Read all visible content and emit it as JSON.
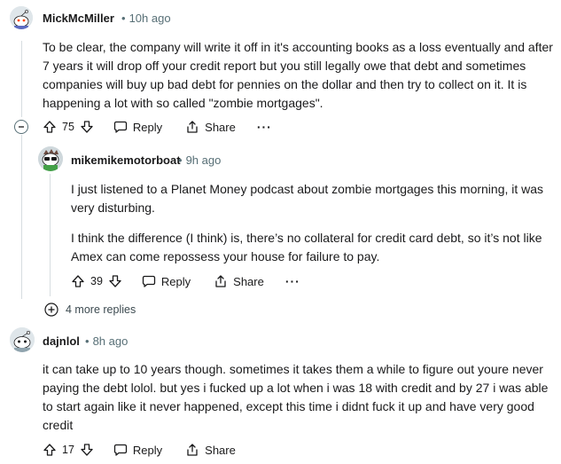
{
  "comments": [
    {
      "author": "MickMcMiller",
      "time": "10h ago",
      "lines": [
        "To be clear, the company will write it off in it's accounting books as a loss eventually and after",
        "7 years it will drop off your credit report but you still legally owe that debt and sometimes",
        "companies will buy up bad debt for pennies on the dollar and then try to collect on it. It is",
        "happening a lot with so called \"zombie mortgages\"."
      ],
      "votes": "75",
      "reply_label": "Reply",
      "share_label": "Share",
      "more_label": "···"
    },
    {
      "author": "mikemikemotorboat",
      "time": "9h ago",
      "lines": [
        "I just listened to a Planet Money podcast about zombie mortgages this morning, it was",
        "very disturbing."
      ],
      "lines2": [
        "I think the difference (I think) is, there’s no collateral for credit card debt, so it’s not like",
        "Amex can come repossess your house for failure to pay."
      ],
      "votes": "39",
      "reply_label": "Reply",
      "share_label": "Share",
      "more_label": "···"
    },
    {
      "author": "dajnlol",
      "time": "8h ago",
      "lines": [
        "it can take up to 10 years though. sometimes it takes them a while to figure out youre never",
        "paying the debt lolol. but yes i fucked up a lot when i was 18 with credit and by 27 i was able",
        "to start again like it never happened, except this time i didnt fuck it up and have very good",
        "credit"
      ],
      "votes": "17",
      "reply_label": "Reply",
      "share_label": "Share",
      "more_label": "···"
    }
  ],
  "more_replies_label": "4 more replies",
  "icons": {
    "upvote": "arrow-up-icon",
    "downvote": "arrow-down-icon",
    "reply": "speech-bubble-icon",
    "share": "share-icon",
    "collapse": "minus-circle-icon",
    "expand": "plus-circle-icon"
  }
}
